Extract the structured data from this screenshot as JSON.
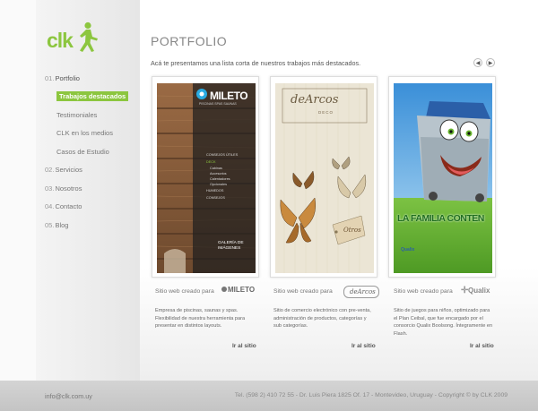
{
  "brand": {
    "logo_text": "clk"
  },
  "nav": {
    "items": [
      {
        "num": "01.",
        "label": "Portfolio",
        "active": true
      },
      {
        "label": "Trabajos destacados",
        "sub": true,
        "highlight": true
      },
      {
        "label": "Testimoniales",
        "sub": true
      },
      {
        "label": "CLK en los medios",
        "sub": true
      },
      {
        "label": "Casos de Estudio",
        "sub": true
      },
      {
        "num": "02.",
        "label": "Servicios"
      },
      {
        "num": "03.",
        "label": "Nosotros"
      },
      {
        "num": "04.",
        "label": "Contacto"
      },
      {
        "num": "05.",
        "label": "Blog"
      }
    ]
  },
  "main": {
    "title": "PORTFOLIO",
    "intro": "Acá te presentamos una lista corta de nuestros trabajos más destacados.",
    "prev_icon": "arrow-left-icon",
    "next_icon": "arrow-right-icon"
  },
  "projects": [
    {
      "site_label": "Sitio web creado para",
      "client": "MILETO",
      "client_tagline": "PISCINAS SPAS SAUNAS",
      "menu": [
        "CONSEJOS ÚTILES",
        "DECK",
        "Cabinas",
        "Accesorios",
        "Calentadores",
        "Opcionales",
        "HUMEDOS",
        "CONSEJOS"
      ],
      "gallery_label": "GALERÍA DE IMÁGENES",
      "description": "Empresa de piscinas, saunas y spas. Flexibilidad de nuestra herramienta para presentar en distintos layouts.",
      "link": "Ir al sitio"
    },
    {
      "site_label": "Sitio web creado para",
      "client": "deArcos",
      "client_tagline": "DECO",
      "tag_text": "Otros",
      "description": "Sitio de comercio electrónico con pre-venta, administración de productos, categorías y sub categorías.",
      "link": "Ir al sitio"
    },
    {
      "site_label": "Sitio web creado para",
      "client": "Qualix",
      "banner": "LA FAMILIA CONTEN",
      "description": "Sitio de juegos para niños, optimizado para el Plan Ceibal, que fue encargado por el consorcio Qualix Boolsong. Íntegramente en Flash.",
      "link": "Ir al sitio"
    }
  ],
  "footer": {
    "email": "info@clk.com.uy",
    "info": "Tel. (598 2) 410 72 55 - Dr. Luis Piera 1825 Of. 17 - Montevideo, Uruguay - Copyright © by CLK 2009"
  },
  "colors": {
    "accent": "#8cc63f"
  }
}
